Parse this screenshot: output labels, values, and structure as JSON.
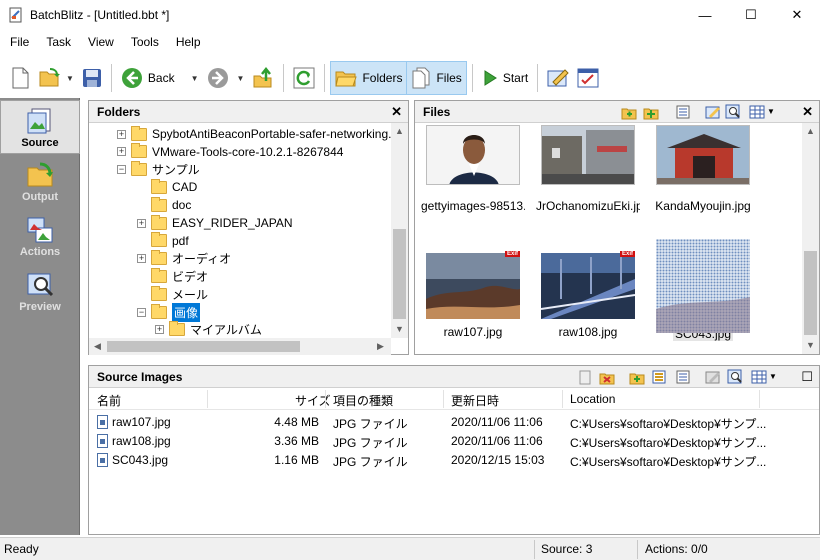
{
  "window": {
    "title": "BatchBlitz - [Untitled.bbt *]",
    "minimize_glyph": "—",
    "maximize_glyph": "☐",
    "close_glyph": "✕"
  },
  "menu": [
    "File",
    "Task",
    "View",
    "Tools",
    "Help"
  ],
  "toolbar": {
    "back_label": "Back",
    "folders_label": "Folders",
    "files_label": "Files",
    "start_label": "Start",
    "dropdown_glyph": "▼",
    "icons": [
      "new-file-icon",
      "open-folder-icon",
      "save-icon",
      "back-arrow-icon",
      "forward-arrow-icon",
      "up-folder-icon",
      "refresh-icon",
      "folders-icon",
      "files-icon",
      "play-icon",
      "edit-task-icon",
      "task-list-icon"
    ]
  },
  "sidebar": {
    "items": [
      {
        "label": "Source",
        "icon": "source-icon",
        "selected": true
      },
      {
        "label": "Output",
        "icon": "output-icon",
        "selected": false
      },
      {
        "label": "Actions",
        "icon": "actions-icon",
        "selected": false
      },
      {
        "label": "Preview",
        "icon": "preview-icon",
        "selected": false
      }
    ]
  },
  "folders_panel": {
    "title": "Folders",
    "close_glyph": "✕",
    "expand_glyph": "+",
    "collapse_glyph": "−",
    "items": [
      {
        "label": "SpybotAntiBeaconPortable-safer-networking.",
        "expander": "+",
        "selected": false
      },
      {
        "label": "VMware-Tools-core-10.2.1-8267844",
        "expander": "+",
        "selected": false
      },
      {
        "label": "サンプル",
        "expander": "−",
        "selected": false
      },
      {
        "label": "CAD",
        "expander": "",
        "selected": false
      },
      {
        "label": "doc",
        "expander": "",
        "selected": false
      },
      {
        "label": "EASY_RIDER_JAPAN",
        "expander": "+",
        "selected": false
      },
      {
        "label": "pdf",
        "expander": "",
        "selected": false
      },
      {
        "label": "オーディオ",
        "expander": "+",
        "selected": false
      },
      {
        "label": "ビデオ",
        "expander": "",
        "selected": false
      },
      {
        "label": "メール",
        "expander": "",
        "selected": false
      },
      {
        "label": "画像",
        "expander": "−",
        "selected": true
      },
      {
        "label": "マイアルバム",
        "expander": "+",
        "selected": false
      }
    ],
    "scroll_up": "▲",
    "scroll_down": "▼",
    "scroll_left": "◀",
    "scroll_right": "▶"
  },
  "files_panel": {
    "title": "Files",
    "close_glyph": "✕",
    "exif_badge": "Exif",
    "items": [
      {
        "name": "gettyimages-98513...",
        "exif": false,
        "selected": false
      },
      {
        "name": "JrOchanomizuEki.jpg",
        "exif": false,
        "selected": false
      },
      {
        "name": "KandaMyoujin.jpg",
        "exif": false,
        "selected": false
      },
      {
        "name": "raw107.jpg",
        "exif": true,
        "selected": false
      },
      {
        "name": "raw108.jpg",
        "exif": true,
        "selected": false
      },
      {
        "name": "SC043.jpg",
        "exif": false,
        "selected": true
      }
    ]
  },
  "source_images": {
    "title": "Source Images",
    "maximize_glyph": "☐",
    "columns": [
      "名前",
      "サイズ",
      "項目の種類",
      "更新日時",
      "Location"
    ],
    "rows": [
      {
        "name": "raw107.jpg",
        "size": "4.48 MB",
        "type": "JPG ファイル",
        "modified": "2020/11/06 11:06",
        "location": "C:¥Users¥softaro¥Desktop¥サンプ..."
      },
      {
        "name": "raw108.jpg",
        "size": "3.36 MB",
        "type": "JPG ファイル",
        "modified": "2020/11/06 11:06",
        "location": "C:¥Users¥softaro¥Desktop¥サンプ..."
      },
      {
        "name": "SC043.jpg",
        "size": "1.16 MB",
        "type": "JPG ファイル",
        "modified": "2020/12/15 15:03",
        "location": "C:¥Users¥softaro¥Desktop¥サンプ..."
      }
    ]
  },
  "status": {
    "ready": "Ready",
    "source": "Source: 3",
    "actions": "Actions: 0/0"
  },
  "colors": {
    "selection": "#0078d7",
    "sidebar_bg": "#8c8c8c",
    "active_tool": "#cce4f7",
    "folder": "#ffd868"
  }
}
